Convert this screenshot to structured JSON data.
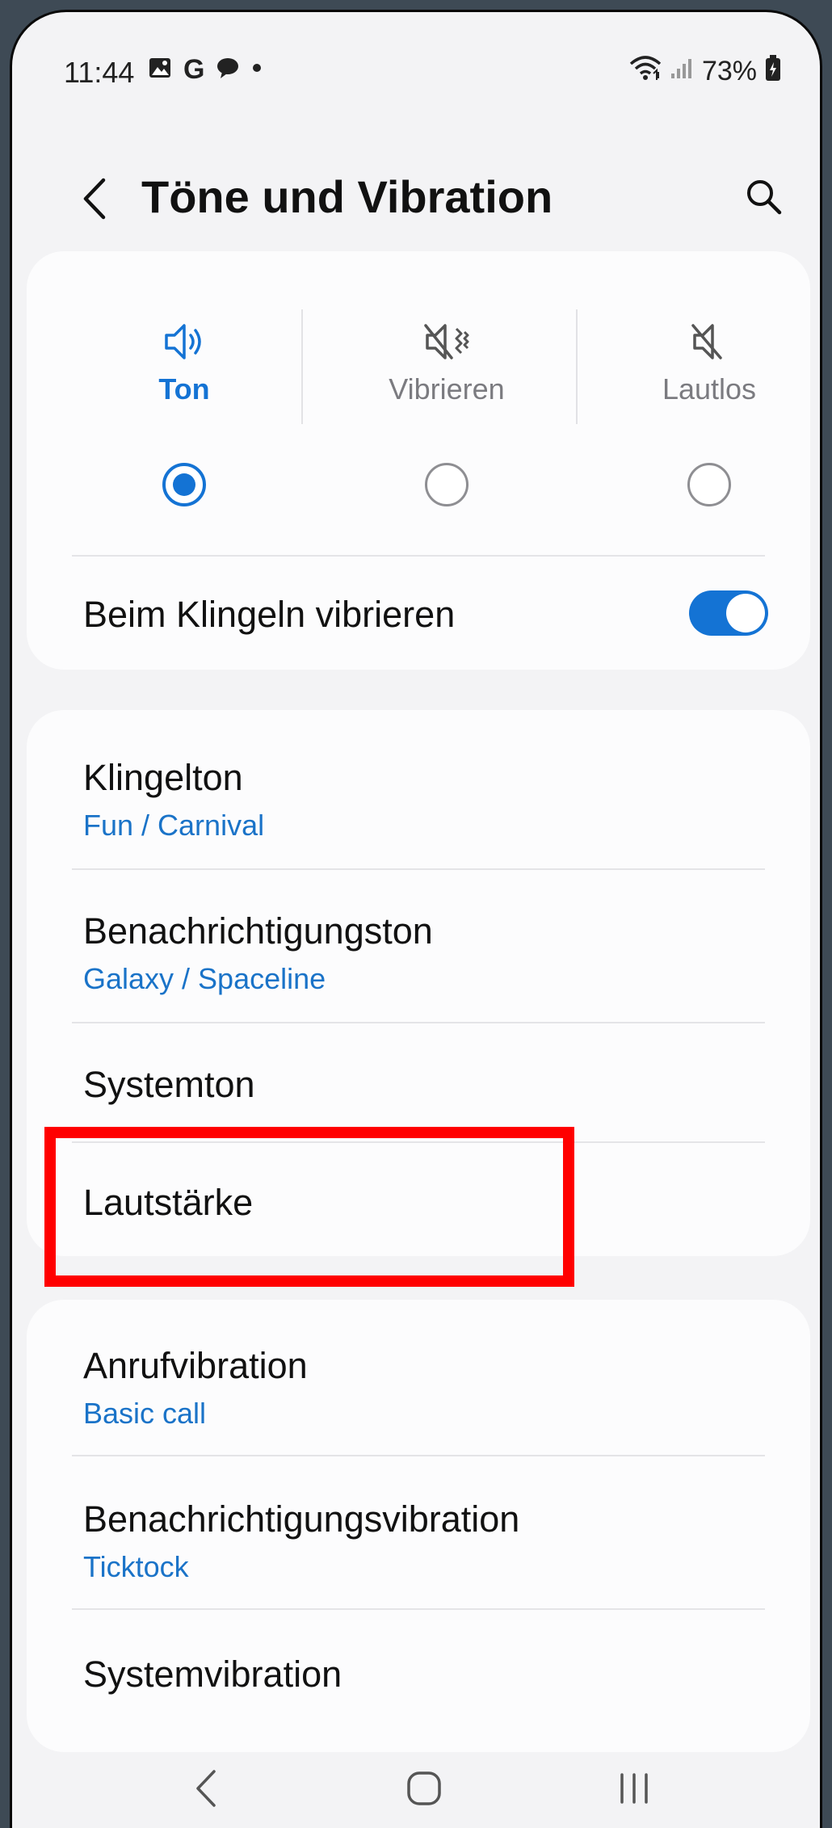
{
  "status_bar": {
    "time": "11:44",
    "notification_icons": [
      "image-icon",
      "google-g-icon",
      "chat-icon",
      "dot-icon"
    ],
    "google_glyph": "G",
    "signal_icons": [
      "wifi-icon",
      "signal-icon"
    ],
    "battery_percent": "73%"
  },
  "header": {
    "title": "Töne und Vibration",
    "back_icon": "chevron-left-icon",
    "search_icon": "search-icon"
  },
  "sound_mode": {
    "options": [
      {
        "label": "Ton",
        "icon": "speaker-sound-icon",
        "selected": true
      },
      {
        "label": "Vibrieren",
        "icon": "speaker-vibrate-icon",
        "selected": false
      },
      {
        "label": "Lautlos",
        "icon": "speaker-mute-icon",
        "selected": false
      }
    ],
    "vibrate_while_ringing": {
      "label": "Beim Klingeln vibrieren",
      "enabled": true
    }
  },
  "sound_settings": [
    {
      "title": "Klingelton",
      "subtitle": "Fun / Carnival"
    },
    {
      "title": "Benachrichtigungston",
      "subtitle": "Galaxy / Spaceline"
    },
    {
      "title": "Systemton"
    },
    {
      "title": "Lautstärke"
    }
  ],
  "vibration_settings": [
    {
      "title": "Anrufvibration",
      "subtitle": "Basic call"
    },
    {
      "title": "Benachrichtigungsvibration",
      "subtitle": "Ticktock"
    },
    {
      "title": "Systemvibration"
    }
  ],
  "navigation_bar": {
    "buttons": [
      "back-icon",
      "home-icon",
      "recents-icon"
    ]
  },
  "colors": {
    "accent": "#1473d4",
    "subtitle": "#1a73c8",
    "highlight": "#ff0000",
    "background": "#f3f3f5",
    "card": "#fcfcfd"
  }
}
